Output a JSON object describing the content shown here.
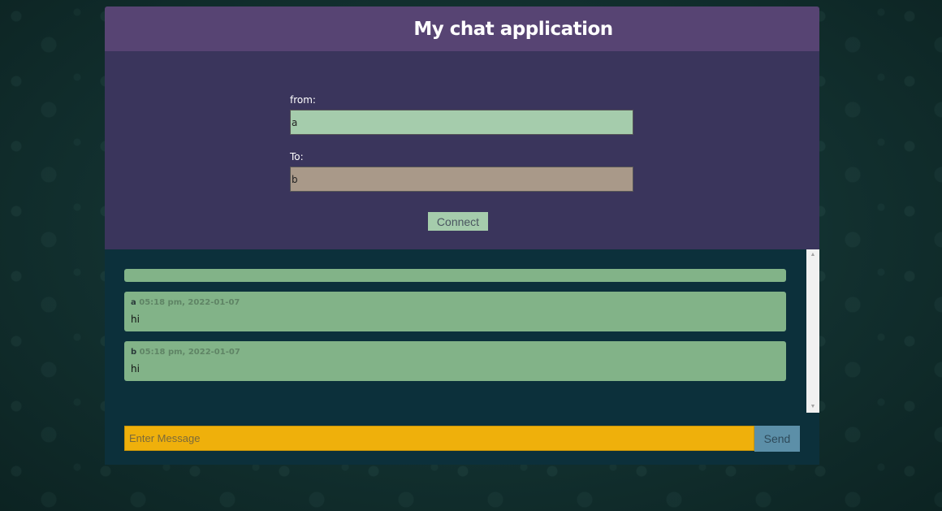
{
  "header": {
    "title": "My chat application"
  },
  "connect_form": {
    "from_label": "from:",
    "from_value": "a",
    "to_label": "To:",
    "to_value": "b",
    "connect_label": "Connect"
  },
  "messages": [
    {
      "sender": "a",
      "time": "05:18 pm, 2022-01-07",
      "text": "hi"
    },
    {
      "sender": "b",
      "time": "05:18 pm, 2022-01-07",
      "text": "hi"
    }
  ],
  "composer": {
    "placeholder": "Enter Message",
    "send_label": "Send"
  },
  "scrollbar": {
    "up_icon": "▲",
    "down_icon": "▼"
  },
  "colors": {
    "header": "#574473",
    "panel": "#3a355c",
    "from_field": "#a5ccac",
    "to_field": "#a99989",
    "chat_bg": "#0c303b",
    "message": "#82b388",
    "input": "#efb00b",
    "send": "#5c8fa8"
  }
}
